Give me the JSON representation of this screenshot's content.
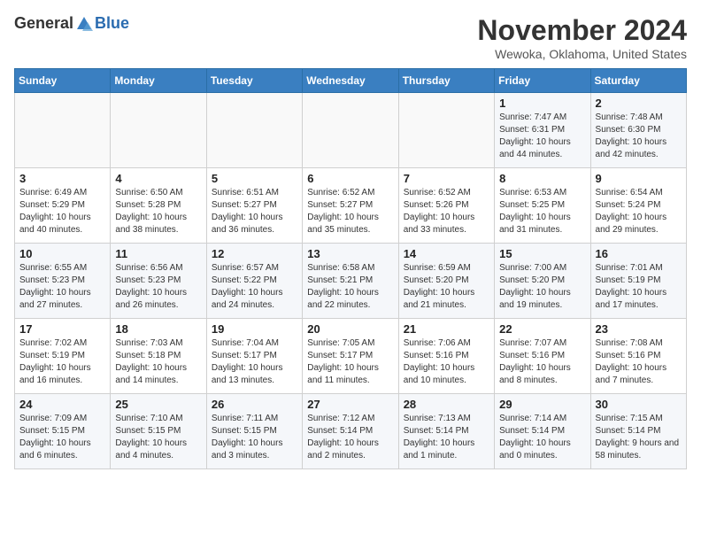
{
  "header": {
    "logo_general": "General",
    "logo_blue": "Blue",
    "month_title": "November 2024",
    "location": "Wewoka, Oklahoma, United States"
  },
  "weekdays": [
    "Sunday",
    "Monday",
    "Tuesday",
    "Wednesday",
    "Thursday",
    "Friday",
    "Saturday"
  ],
  "weeks": [
    [
      {
        "day": "",
        "info": ""
      },
      {
        "day": "",
        "info": ""
      },
      {
        "day": "",
        "info": ""
      },
      {
        "day": "",
        "info": ""
      },
      {
        "day": "",
        "info": ""
      },
      {
        "day": "1",
        "info": "Sunrise: 7:47 AM\nSunset: 6:31 PM\nDaylight: 10 hours and 44 minutes."
      },
      {
        "day": "2",
        "info": "Sunrise: 7:48 AM\nSunset: 6:30 PM\nDaylight: 10 hours and 42 minutes."
      }
    ],
    [
      {
        "day": "3",
        "info": "Sunrise: 6:49 AM\nSunset: 5:29 PM\nDaylight: 10 hours and 40 minutes."
      },
      {
        "day": "4",
        "info": "Sunrise: 6:50 AM\nSunset: 5:28 PM\nDaylight: 10 hours and 38 minutes."
      },
      {
        "day": "5",
        "info": "Sunrise: 6:51 AM\nSunset: 5:27 PM\nDaylight: 10 hours and 36 minutes."
      },
      {
        "day": "6",
        "info": "Sunrise: 6:52 AM\nSunset: 5:27 PM\nDaylight: 10 hours and 35 minutes."
      },
      {
        "day": "7",
        "info": "Sunrise: 6:52 AM\nSunset: 5:26 PM\nDaylight: 10 hours and 33 minutes."
      },
      {
        "day": "8",
        "info": "Sunrise: 6:53 AM\nSunset: 5:25 PM\nDaylight: 10 hours and 31 minutes."
      },
      {
        "day": "9",
        "info": "Sunrise: 6:54 AM\nSunset: 5:24 PM\nDaylight: 10 hours and 29 minutes."
      }
    ],
    [
      {
        "day": "10",
        "info": "Sunrise: 6:55 AM\nSunset: 5:23 PM\nDaylight: 10 hours and 27 minutes."
      },
      {
        "day": "11",
        "info": "Sunrise: 6:56 AM\nSunset: 5:23 PM\nDaylight: 10 hours and 26 minutes."
      },
      {
        "day": "12",
        "info": "Sunrise: 6:57 AM\nSunset: 5:22 PM\nDaylight: 10 hours and 24 minutes."
      },
      {
        "day": "13",
        "info": "Sunrise: 6:58 AM\nSunset: 5:21 PM\nDaylight: 10 hours and 22 minutes."
      },
      {
        "day": "14",
        "info": "Sunrise: 6:59 AM\nSunset: 5:20 PM\nDaylight: 10 hours and 21 minutes."
      },
      {
        "day": "15",
        "info": "Sunrise: 7:00 AM\nSunset: 5:20 PM\nDaylight: 10 hours and 19 minutes."
      },
      {
        "day": "16",
        "info": "Sunrise: 7:01 AM\nSunset: 5:19 PM\nDaylight: 10 hours and 17 minutes."
      }
    ],
    [
      {
        "day": "17",
        "info": "Sunrise: 7:02 AM\nSunset: 5:19 PM\nDaylight: 10 hours and 16 minutes."
      },
      {
        "day": "18",
        "info": "Sunrise: 7:03 AM\nSunset: 5:18 PM\nDaylight: 10 hours and 14 minutes."
      },
      {
        "day": "19",
        "info": "Sunrise: 7:04 AM\nSunset: 5:17 PM\nDaylight: 10 hours and 13 minutes."
      },
      {
        "day": "20",
        "info": "Sunrise: 7:05 AM\nSunset: 5:17 PM\nDaylight: 10 hours and 11 minutes."
      },
      {
        "day": "21",
        "info": "Sunrise: 7:06 AM\nSunset: 5:16 PM\nDaylight: 10 hours and 10 minutes."
      },
      {
        "day": "22",
        "info": "Sunrise: 7:07 AM\nSunset: 5:16 PM\nDaylight: 10 hours and 8 minutes."
      },
      {
        "day": "23",
        "info": "Sunrise: 7:08 AM\nSunset: 5:16 PM\nDaylight: 10 hours and 7 minutes."
      }
    ],
    [
      {
        "day": "24",
        "info": "Sunrise: 7:09 AM\nSunset: 5:15 PM\nDaylight: 10 hours and 6 minutes."
      },
      {
        "day": "25",
        "info": "Sunrise: 7:10 AM\nSunset: 5:15 PM\nDaylight: 10 hours and 4 minutes."
      },
      {
        "day": "26",
        "info": "Sunrise: 7:11 AM\nSunset: 5:15 PM\nDaylight: 10 hours and 3 minutes."
      },
      {
        "day": "27",
        "info": "Sunrise: 7:12 AM\nSunset: 5:14 PM\nDaylight: 10 hours and 2 minutes."
      },
      {
        "day": "28",
        "info": "Sunrise: 7:13 AM\nSunset: 5:14 PM\nDaylight: 10 hours and 1 minute."
      },
      {
        "day": "29",
        "info": "Sunrise: 7:14 AM\nSunset: 5:14 PM\nDaylight: 10 hours and 0 minutes."
      },
      {
        "day": "30",
        "info": "Sunrise: 7:15 AM\nSunset: 5:14 PM\nDaylight: 9 hours and 58 minutes."
      }
    ]
  ]
}
